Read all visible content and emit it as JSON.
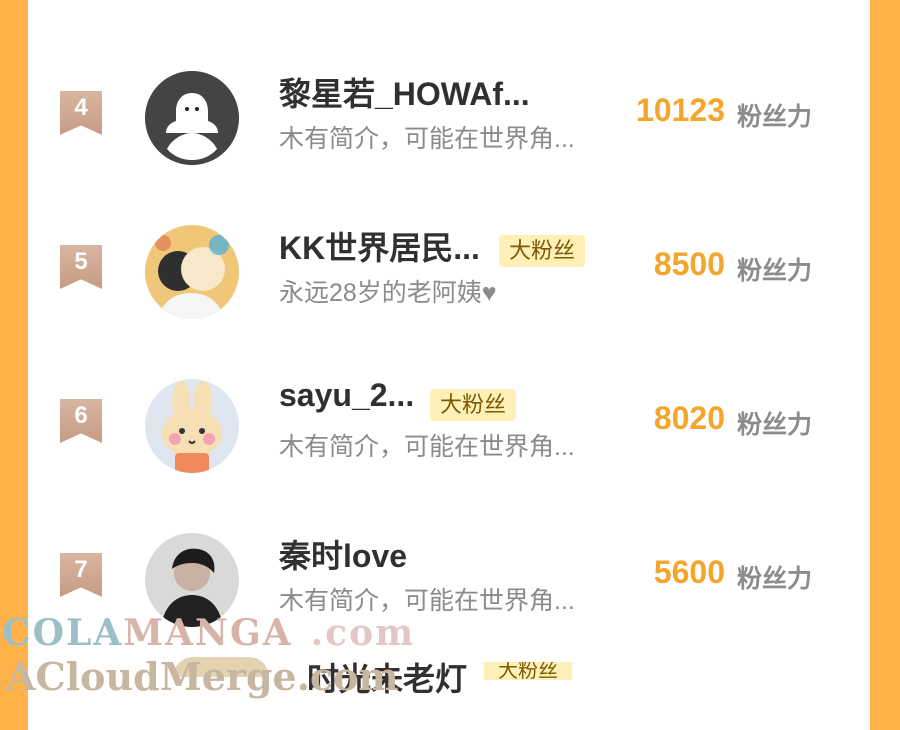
{
  "labels": {
    "unit": "粉丝力",
    "bigfan": "大粉丝"
  },
  "rows": [
    {
      "rank": "4",
      "name": "黎星若_HOWAf...",
      "bio": "木有简介，可能在世界角...",
      "score": "10123",
      "badge": ""
    },
    {
      "rank": "5",
      "name": "KK世界居民...",
      "bio": "永远28岁的老阿姨♥",
      "score": "8500",
      "badge": "大粉丝"
    },
    {
      "rank": "6",
      "name": "sayu_2...",
      "bio": "木有简介，可能在世界角...",
      "score": "8020",
      "badge": "大粉丝"
    },
    {
      "rank": "7",
      "name": "秦时love",
      "bio": "木有简介，可能在世界角...",
      "score": "5600",
      "badge": ""
    }
  ],
  "partial_next": {
    "name": "时光未老灯",
    "badge": "大粉丝"
  },
  "watermark": {
    "line1_a": "COLA",
    "line1_b": "MANGA",
    "line1_c": ".com",
    "line2": "ACloudMerge.com"
  },
  "colors": {
    "accent_score": "#f4a52b",
    "background_orange": "#ffb24a",
    "badge_bg": "#fff0b8",
    "rank_flag": "#c79b84"
  }
}
